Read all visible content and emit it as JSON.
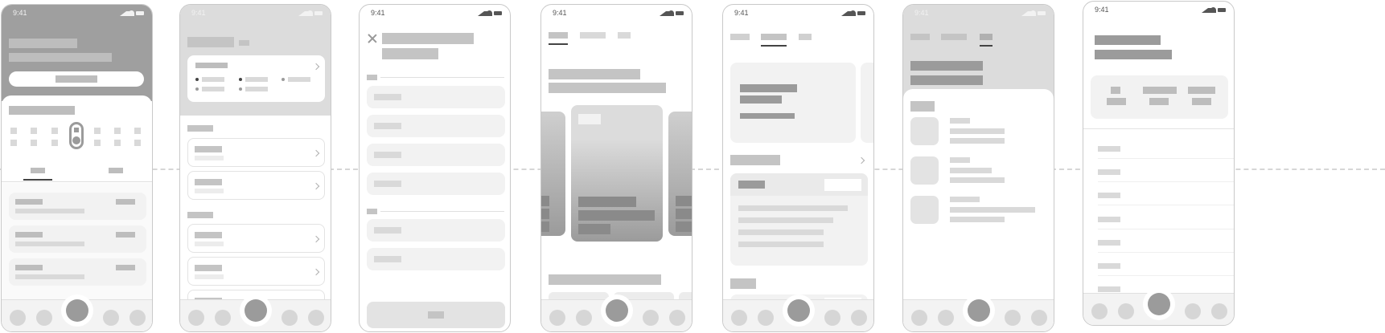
{
  "status_bar": {
    "time": "9:41",
    "icons": [
      "signal-icon",
      "wifi-icon",
      "battery-icon"
    ]
  },
  "colors": {
    "dark_placeholder": "#9b9b9b",
    "mid_placeholder": "#bdbdbd",
    "light_placeholder": "#d9d9d9",
    "card": "#f2f2f2",
    "connector": "#d6d6d6"
  },
  "screens": [
    {
      "id": "screen-1"
    },
    {
      "id": "screen-2"
    },
    {
      "id": "screen-3"
    },
    {
      "id": "screen-4"
    },
    {
      "id": "screen-5"
    },
    {
      "id": "screen-6"
    },
    {
      "id": "screen-7"
    }
  ]
}
